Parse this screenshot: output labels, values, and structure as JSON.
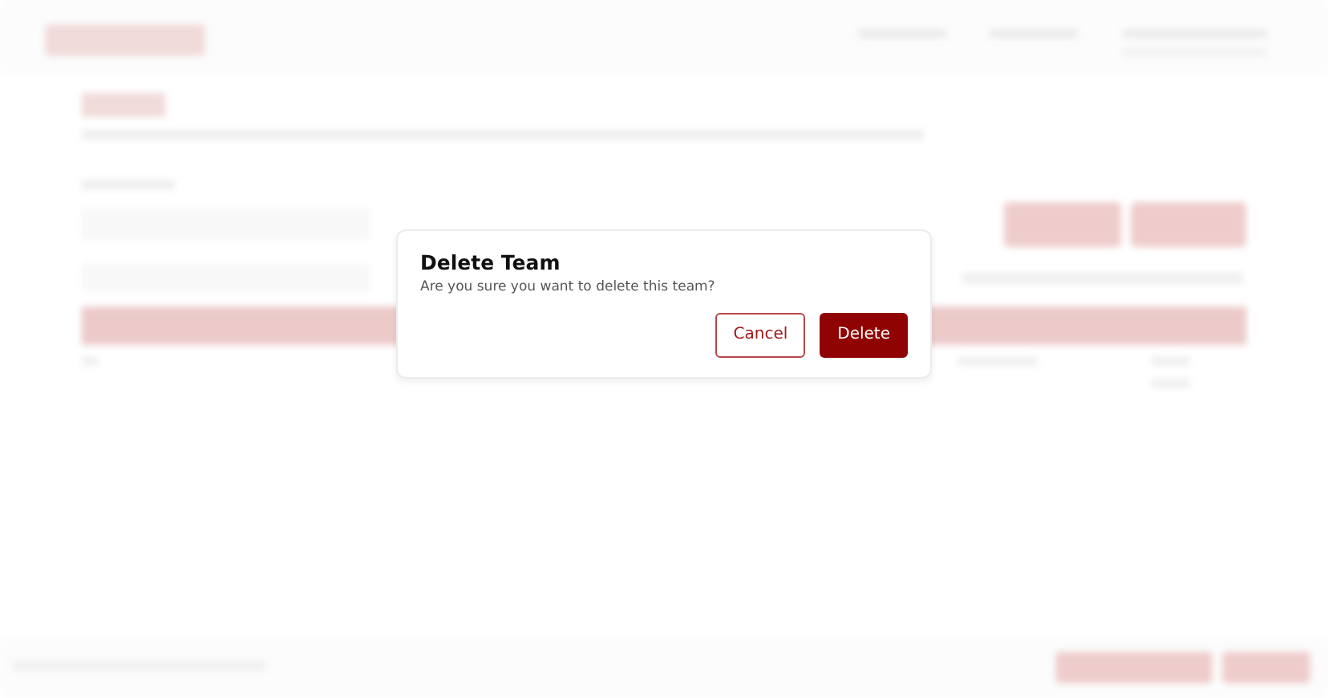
{
  "dialog": {
    "title": "Delete Team",
    "message": "Are you sure you want to delete this team?",
    "buttons": [
      {
        "label": "Cancel",
        "kind": "secondary"
      },
      {
        "label": "Delete",
        "kind": "danger"
      }
    ]
  }
}
